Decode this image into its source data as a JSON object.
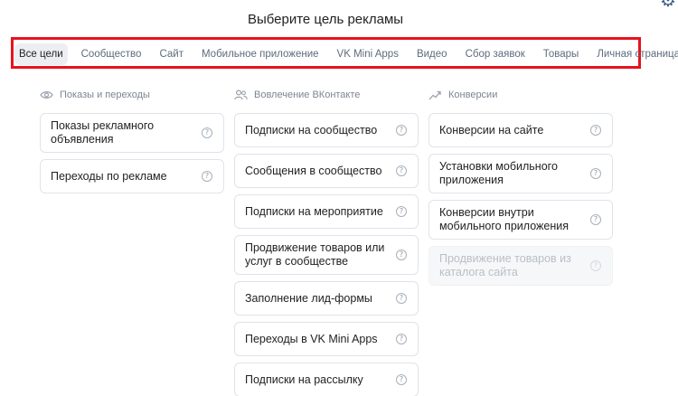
{
  "page": {
    "title": "Выберите цель рекламы",
    "corner_icon": "gear-icon"
  },
  "tabs": [
    {
      "label": "Все цели",
      "active": true
    },
    {
      "label": "Сообщество"
    },
    {
      "label": "Сайт"
    },
    {
      "label": "Мобильное приложение"
    },
    {
      "label": "VK Mini Apps"
    },
    {
      "label": "Видео"
    },
    {
      "label": "Сбор заявок"
    },
    {
      "label": "Товары"
    },
    {
      "label": "Личная страница"
    }
  ],
  "highlight_color": "#e8121d",
  "columns": [
    {
      "title": "Показы и переходы",
      "icon": "eye-icon",
      "items": [
        {
          "label": "Показы рекламного объявления",
          "disabled": false
        },
        {
          "label": "Переходы по рекламе",
          "disabled": false
        }
      ]
    },
    {
      "title": "Вовлечение ВКонтакте",
      "icon": "users-icon",
      "items": [
        {
          "label": "Подписки на сообщество",
          "disabled": false
        },
        {
          "label": "Сообщения в сообщество",
          "disabled": false
        },
        {
          "label": "Подписки на мероприятие",
          "disabled": false
        },
        {
          "label": "Продвижение товаров или услуг в сообществе",
          "disabled": false
        },
        {
          "label": "Заполнение лид-формы",
          "disabled": false
        },
        {
          "label": "Переходы в VK Mini Apps",
          "disabled": false
        },
        {
          "label": "Подписки на рассылку",
          "disabled": false
        }
      ]
    },
    {
      "title": "Конверсии",
      "icon": "trend-icon",
      "items": [
        {
          "label": "Конверсии на сайте",
          "disabled": false
        },
        {
          "label": "Установки мобильного приложения",
          "disabled": false
        },
        {
          "label": "Конверсии внутри мобильного приложения",
          "disabled": false
        },
        {
          "label": "Продвижение товаров из каталога сайта",
          "disabled": true
        }
      ]
    }
  ],
  "help_icon": "?"
}
